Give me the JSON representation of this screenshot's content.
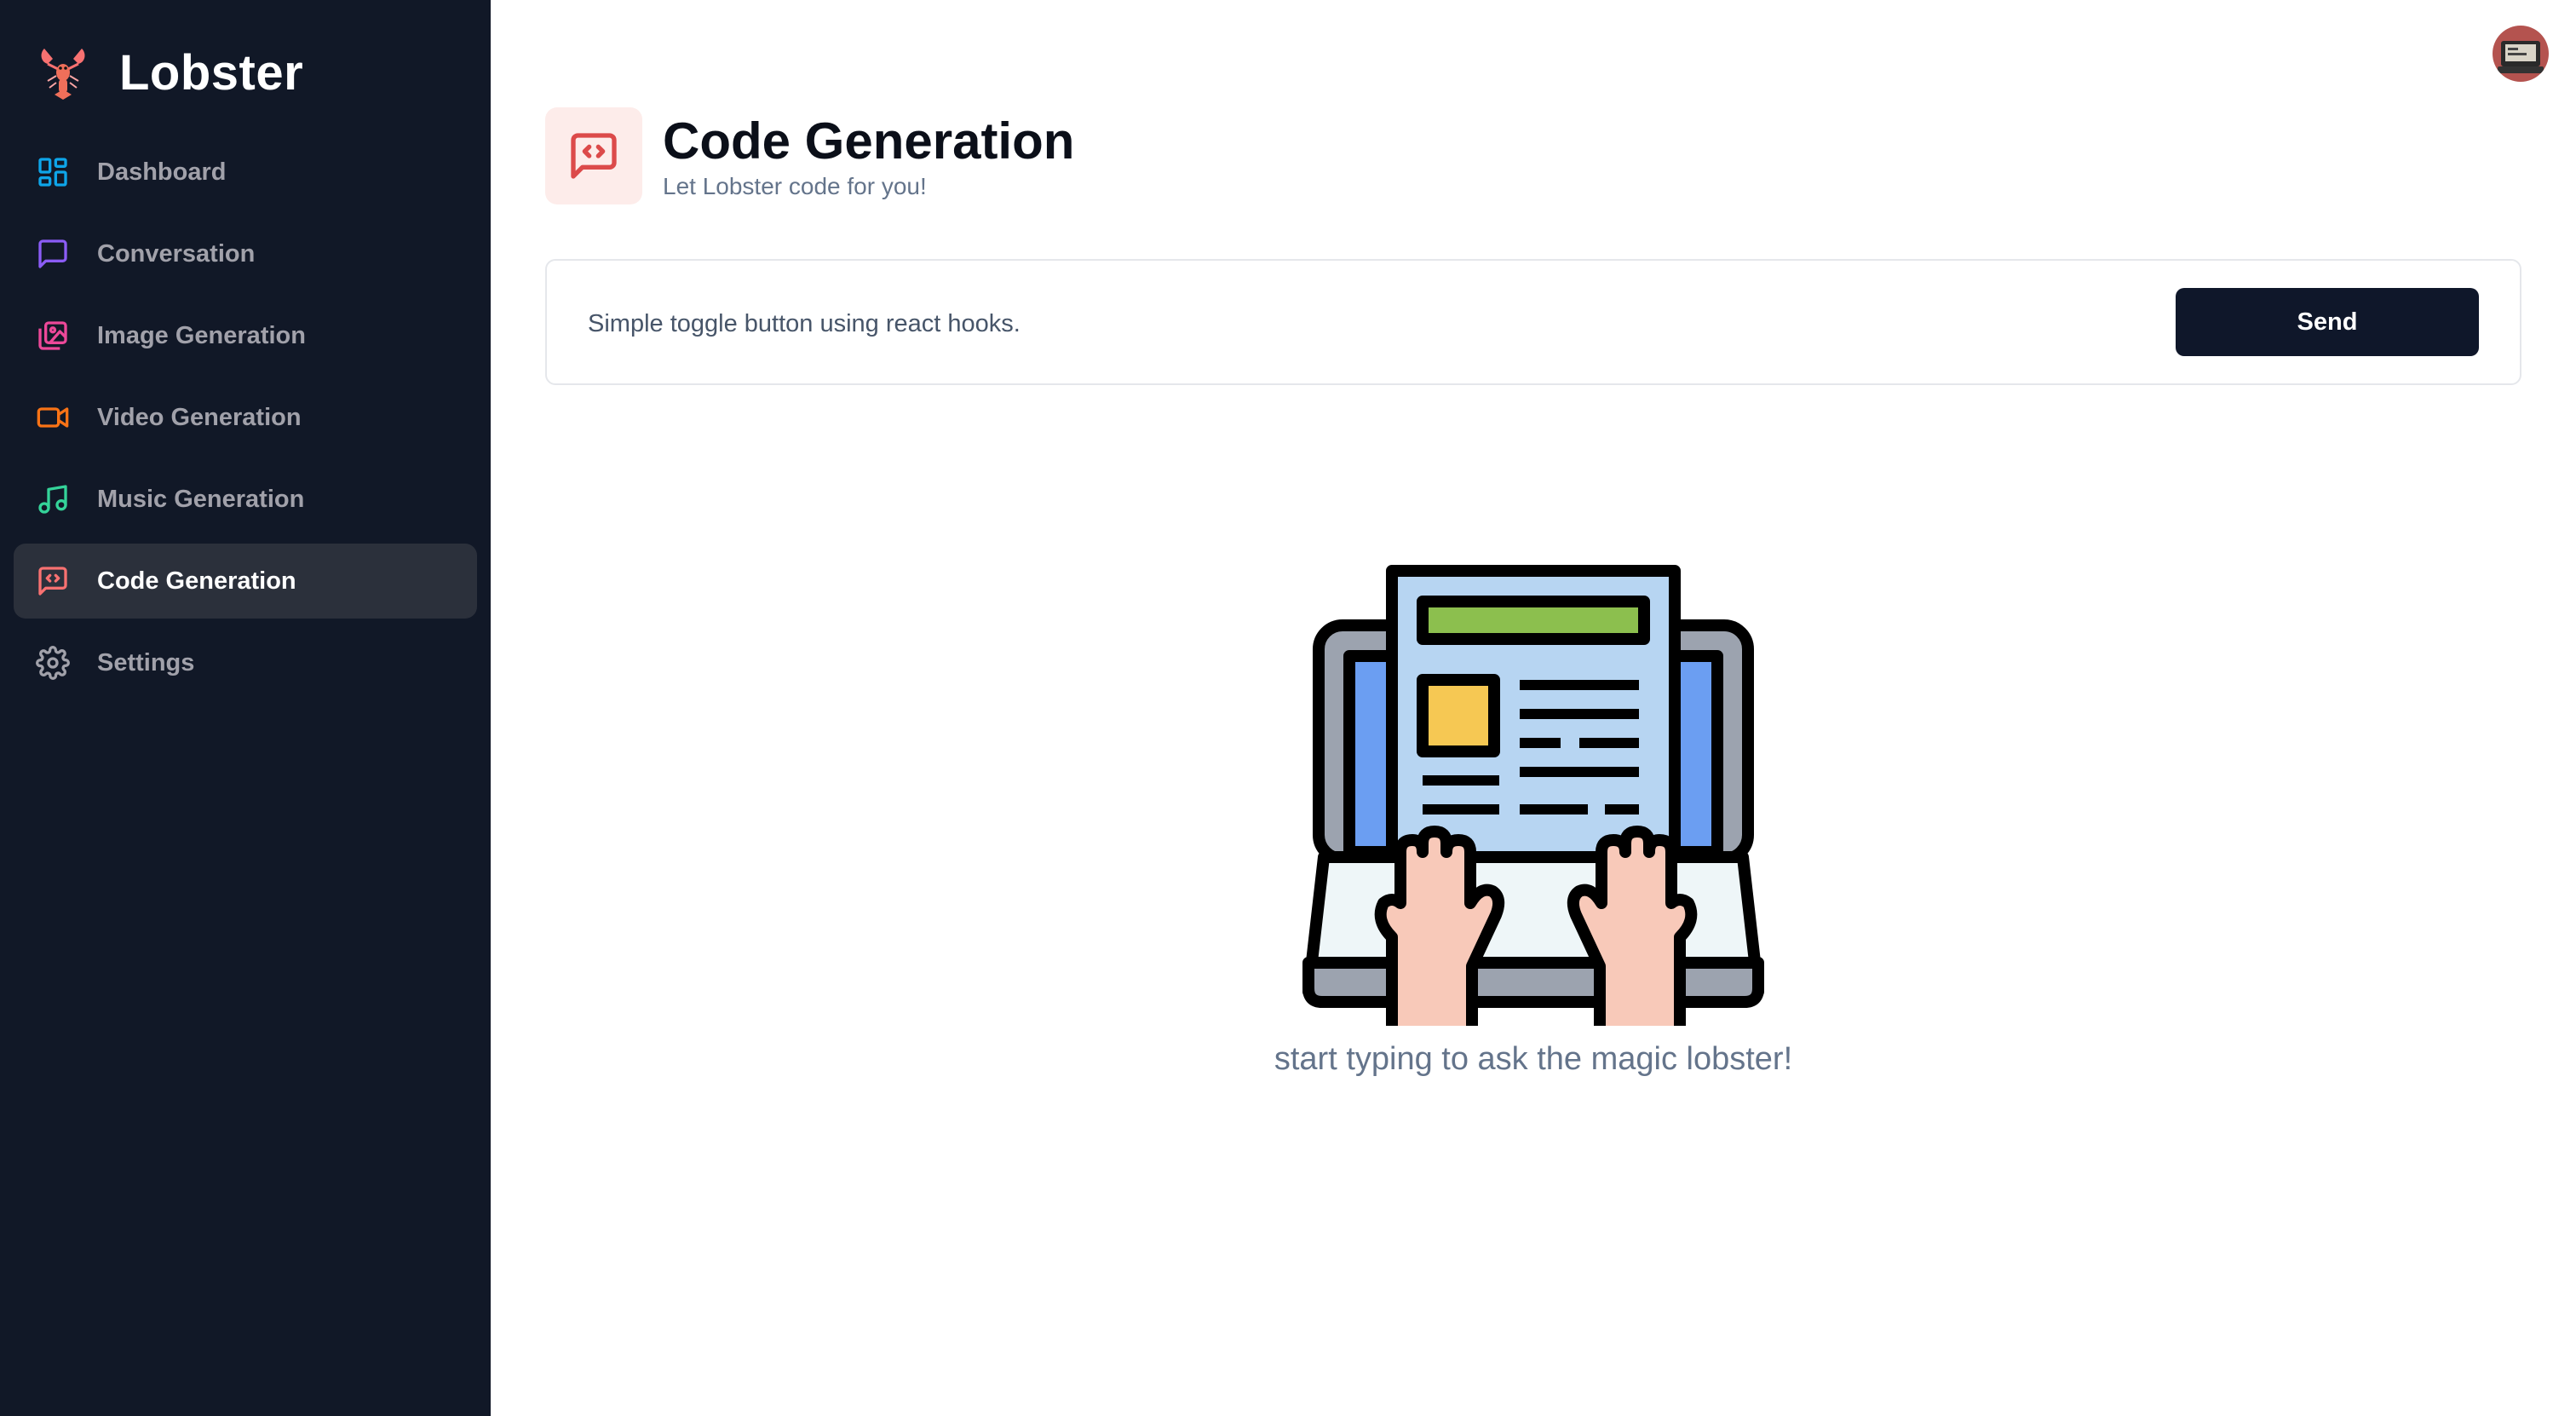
{
  "app": {
    "name": "Lobster"
  },
  "sidebar": {
    "items": [
      {
        "label": "Dashboard",
        "icon": "dashboard-icon",
        "color": "#0ea5e9",
        "active": false
      },
      {
        "label": "Conversation",
        "icon": "chat-icon",
        "color": "#8b5cf6",
        "active": false
      },
      {
        "label": "Image Generation",
        "icon": "image-icon",
        "color": "#ec4899",
        "active": false
      },
      {
        "label": "Video Generation",
        "icon": "video-icon",
        "color": "#f97316",
        "active": false
      },
      {
        "label": "Music Generation",
        "icon": "music-icon",
        "color": "#34d399",
        "active": false
      },
      {
        "label": "Code Generation",
        "icon": "code-chat-icon",
        "color": "#f87171",
        "active": true
      },
      {
        "label": "Settings",
        "icon": "gear-icon",
        "color": "#a1a1aa",
        "active": false
      }
    ]
  },
  "header": {
    "title": "Code Generation",
    "subtitle": "Let Lobster code for you!",
    "icon": "code-chat-icon",
    "icon_color": "#dc4a4a",
    "icon_bg": "#fdecea"
  },
  "prompt": {
    "value": "Simple toggle button using react hooks.",
    "send_label": "Send"
  },
  "empty_state": {
    "message": "start typing to ask the magic lobster!",
    "illustration": "laptop-typing-illustration"
  },
  "colors": {
    "sidebar_bg": "#111827",
    "active_item_bg": "#2b303b",
    "button_bg": "#0f172a"
  }
}
